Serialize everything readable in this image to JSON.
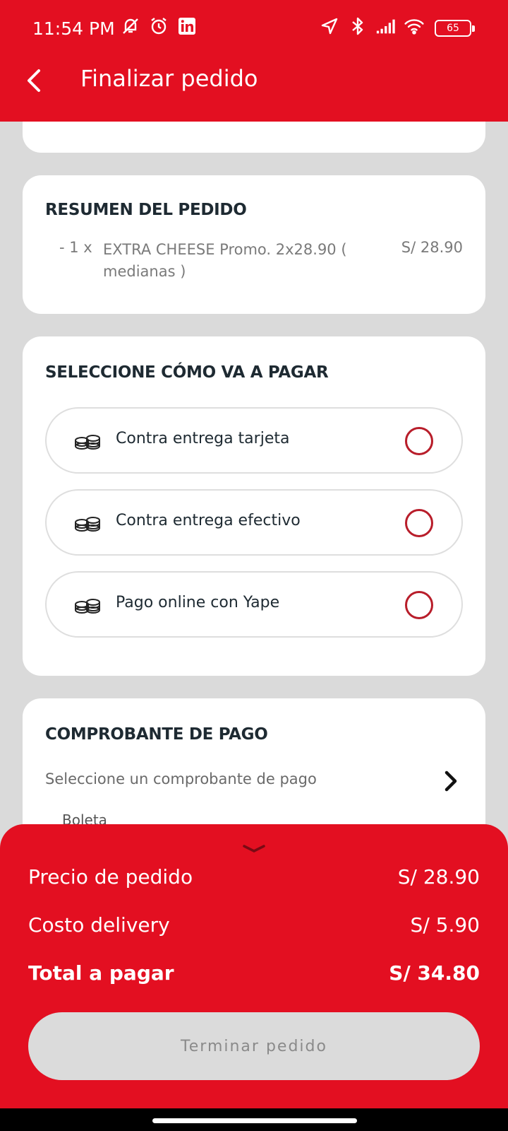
{
  "status_bar": {
    "time": "11:54 PM",
    "battery": "65",
    "icons_left": [
      "muted-bell-icon",
      "alarm-icon",
      "linkedin-icon"
    ],
    "icons_right": [
      "location-arrow-icon",
      "bluetooth-icon",
      "signal-icon",
      "wifi-icon",
      "battery-icon"
    ]
  },
  "header": {
    "title": "Finalizar pedido",
    "back_icon": "chevron-left-icon"
  },
  "order_summary": {
    "title": "RESUMEN DEL PEDIDO",
    "items": [
      {
        "qty": "- 1 x",
        "name": "EXTRA CHEESE Promo. 2x28.90 ( medianas )",
        "price": "S/ 28.90"
      }
    ]
  },
  "payment": {
    "title": "SELECCIONE CÓMO VA A PAGAR",
    "options": [
      {
        "label": "Contra entrega tarjeta",
        "icon": "coins-icon",
        "selected": false
      },
      {
        "label": "Contra entrega efectivo",
        "icon": "coins-icon",
        "selected": false
      },
      {
        "label": "Pago online con Yape",
        "icon": "coins-icon",
        "selected": false
      }
    ]
  },
  "receipt": {
    "title": "COMPROBANTE DE PAGO",
    "placeholder": "Seleccione un comprobante de pago",
    "value": "Boleta"
  },
  "totals": {
    "order_price_label": "Precio de pedido",
    "order_price": "S/ 28.90",
    "delivery_label": "Costo delivery",
    "delivery": "S/ 5.90",
    "total_label": "Total a pagar",
    "total": "S/ 34.80"
  },
  "finish_button": "Terminar pedido",
  "colors": {
    "brand_red": "#e30f21",
    "radio_red": "#b81d2a",
    "background": "#dadada",
    "button_disabled": "#dbdbdb"
  }
}
